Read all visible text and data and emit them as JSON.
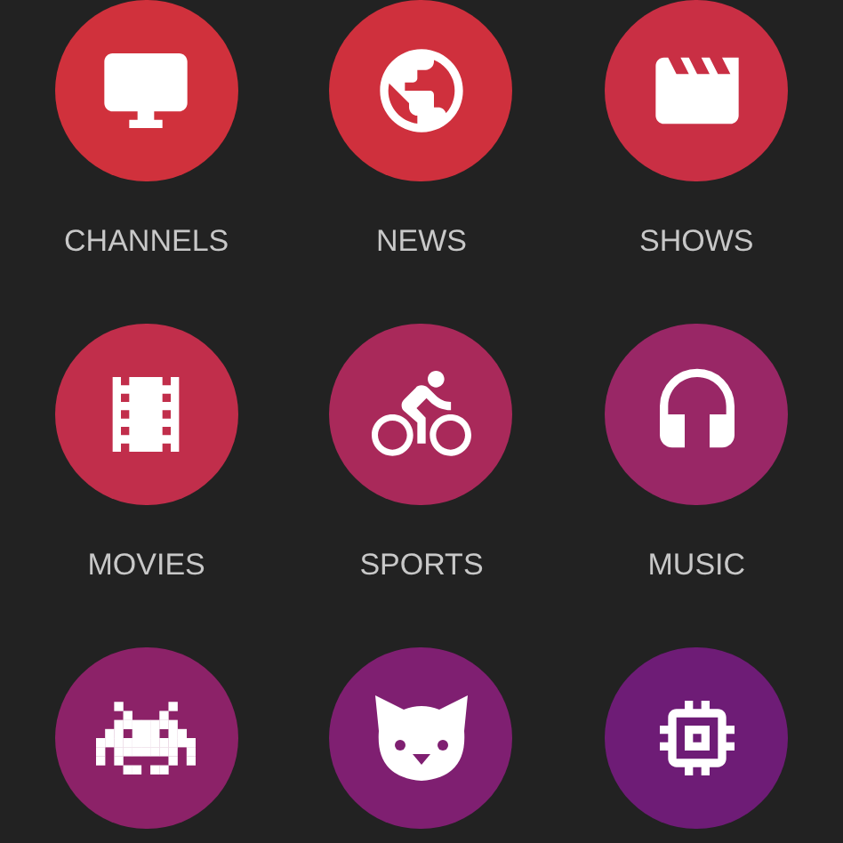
{
  "categories": [
    {
      "kind": "tv",
      "label": "CHANNELS",
      "color": "#d0313c"
    },
    {
      "kind": "globe",
      "label": "NEWS",
      "color": "#cf303d"
    },
    {
      "kind": "clapperboard",
      "label": "SHOWS",
      "color": "#c92f44"
    },
    {
      "kind": "film",
      "label": "MOVIES",
      "color": "#c12e4b"
    },
    {
      "kind": "bike",
      "label": "SPORTS",
      "color": "#a9295a"
    },
    {
      "kind": "headphones",
      "label": "MUSIC",
      "color": "#992766"
    },
    {
      "kind": "invader",
      "color": "#8c2268"
    },
    {
      "kind": "cat",
      "color": "#7f1f71"
    },
    {
      "kind": "chip",
      "color": "#6e1c76"
    }
  ]
}
